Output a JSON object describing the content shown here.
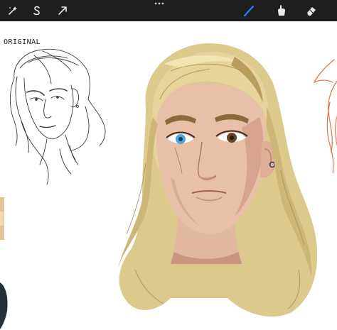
{
  "toolbar": {
    "left_tools": [
      {
        "icon": "adjustments-wand-icon"
      },
      {
        "icon": "selection-s-icon"
      },
      {
        "icon": "transform-arrow-icon"
      }
    ],
    "more_icon": "more-dots-icon",
    "right_tools": [
      {
        "icon": "brush-icon",
        "active": true
      },
      {
        "icon": "smudge-icon"
      },
      {
        "icon": "eraser-icon"
      }
    ],
    "colors": {
      "background": "#1e1e1e",
      "icon": "#e8e8e8",
      "active": "#2f7bf5"
    }
  },
  "canvas": {
    "label_original": "ORIGINAL"
  }
}
